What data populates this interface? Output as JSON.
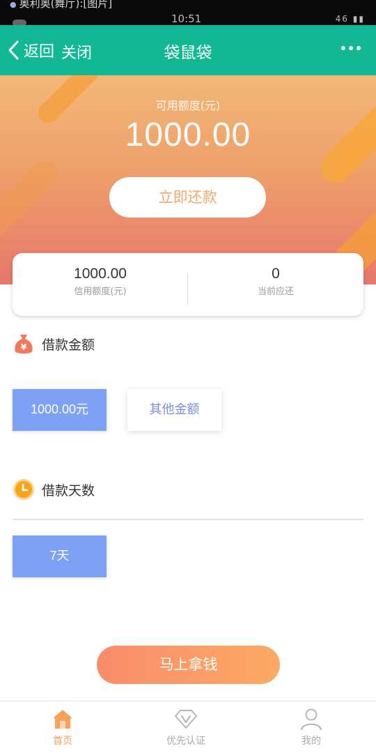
{
  "status_bar": {
    "notification": "奥利奥(舞厅):[图片]",
    "time": "10:51",
    "signal": "46"
  },
  "header": {
    "back_label": "返回",
    "close_label": "关闭",
    "title": "袋鼠袋"
  },
  "hero": {
    "available_label": "可用额度(元)",
    "available_value": "1000.00",
    "repay_button": "立即还款"
  },
  "summary": {
    "credit_value": "1000.00",
    "credit_label": "信用额度(元)",
    "due_value": "0",
    "due_label": "当前应还"
  },
  "loan_amount": {
    "title": "借款金额",
    "options": [
      {
        "label": "1000.00元",
        "selected": true
      },
      {
        "label": "其他金额",
        "selected": false
      }
    ]
  },
  "loan_days": {
    "title": "借款天数",
    "options": [
      {
        "label": "7天",
        "selected": true
      }
    ]
  },
  "cta": {
    "label": "马上拿钱"
  },
  "tabbar": {
    "items": [
      {
        "label": "首页",
        "icon": "home-icon",
        "active": true
      },
      {
        "label": "优先认证",
        "icon": "v-badge-icon",
        "active": false
      },
      {
        "label": "我的",
        "icon": "user-icon",
        "active": false
      }
    ]
  },
  "colors": {
    "header_bg": "#12b894",
    "accent_orange": "#f3a76c",
    "selected_option": "#7fa1f5"
  }
}
